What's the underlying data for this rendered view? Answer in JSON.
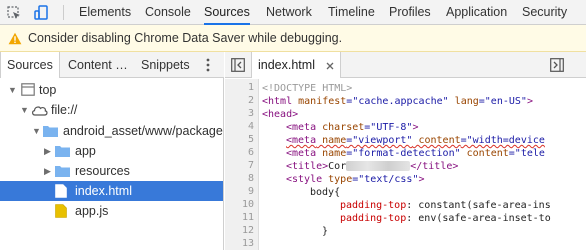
{
  "topbar": {
    "tabs": [
      "Elements",
      "Console",
      "Sources",
      "Network",
      "Timeline",
      "Profiles",
      "Application",
      "Security"
    ],
    "active_tab": "Sources"
  },
  "warning": {
    "message": "Consider disabling Chrome Data Saver while debugging."
  },
  "navigator": {
    "tabs": [
      "Sources",
      "Content …",
      "Snippets"
    ],
    "tree": [
      {
        "label": "top"
      },
      {
        "label": "file://"
      },
      {
        "label": "android_asset/www/package"
      },
      {
        "label": "app"
      },
      {
        "label": "resources"
      },
      {
        "label": "index.html"
      },
      {
        "label": "app.js"
      }
    ]
  },
  "editor": {
    "file_tab": "index.html",
    "line_numbers": [
      "1",
      "2",
      "3",
      "4",
      "5",
      "6",
      "7",
      "8",
      "9",
      "10",
      "11",
      "12",
      "13"
    ],
    "lines": [
      {
        "p": [
          "<!DOCTYPE HTML>"
        ]
      },
      {
        "p": [
          "<html",
          " manifest",
          "=\"cache.appcache\"",
          " lang",
          "=\"en-US\"",
          ">"
        ]
      },
      {
        "p": [
          "<head>"
        ]
      },
      {
        "p": [
          "<meta",
          " charset",
          "=\"UTF-8\"",
          ">"
        ]
      },
      {
        "p": [
          "<meta",
          " name",
          "=\"viewport\"",
          " content",
          "=\"width=device"
        ]
      },
      {
        "p": [
          "<meta",
          " name",
          "=\"format-detection\"",
          " content",
          "=\"tele"
        ]
      },
      {
        "p": [
          "<title>",
          "Cor",
          "</title>"
        ]
      },
      {
        "p": [
          "<style",
          " type",
          "=\"text/css\"",
          ">"
        ]
      },
      {
        "p": [
          "body{"
        ]
      },
      {
        "p": [
          "padding-top",
          ": constant(safe-area-ins"
        ]
      },
      {
        "p": [
          "padding-top",
          ": env(safe-area-inset-to"
        ]
      },
      {
        "p": [
          "}"
        ]
      }
    ]
  }
}
